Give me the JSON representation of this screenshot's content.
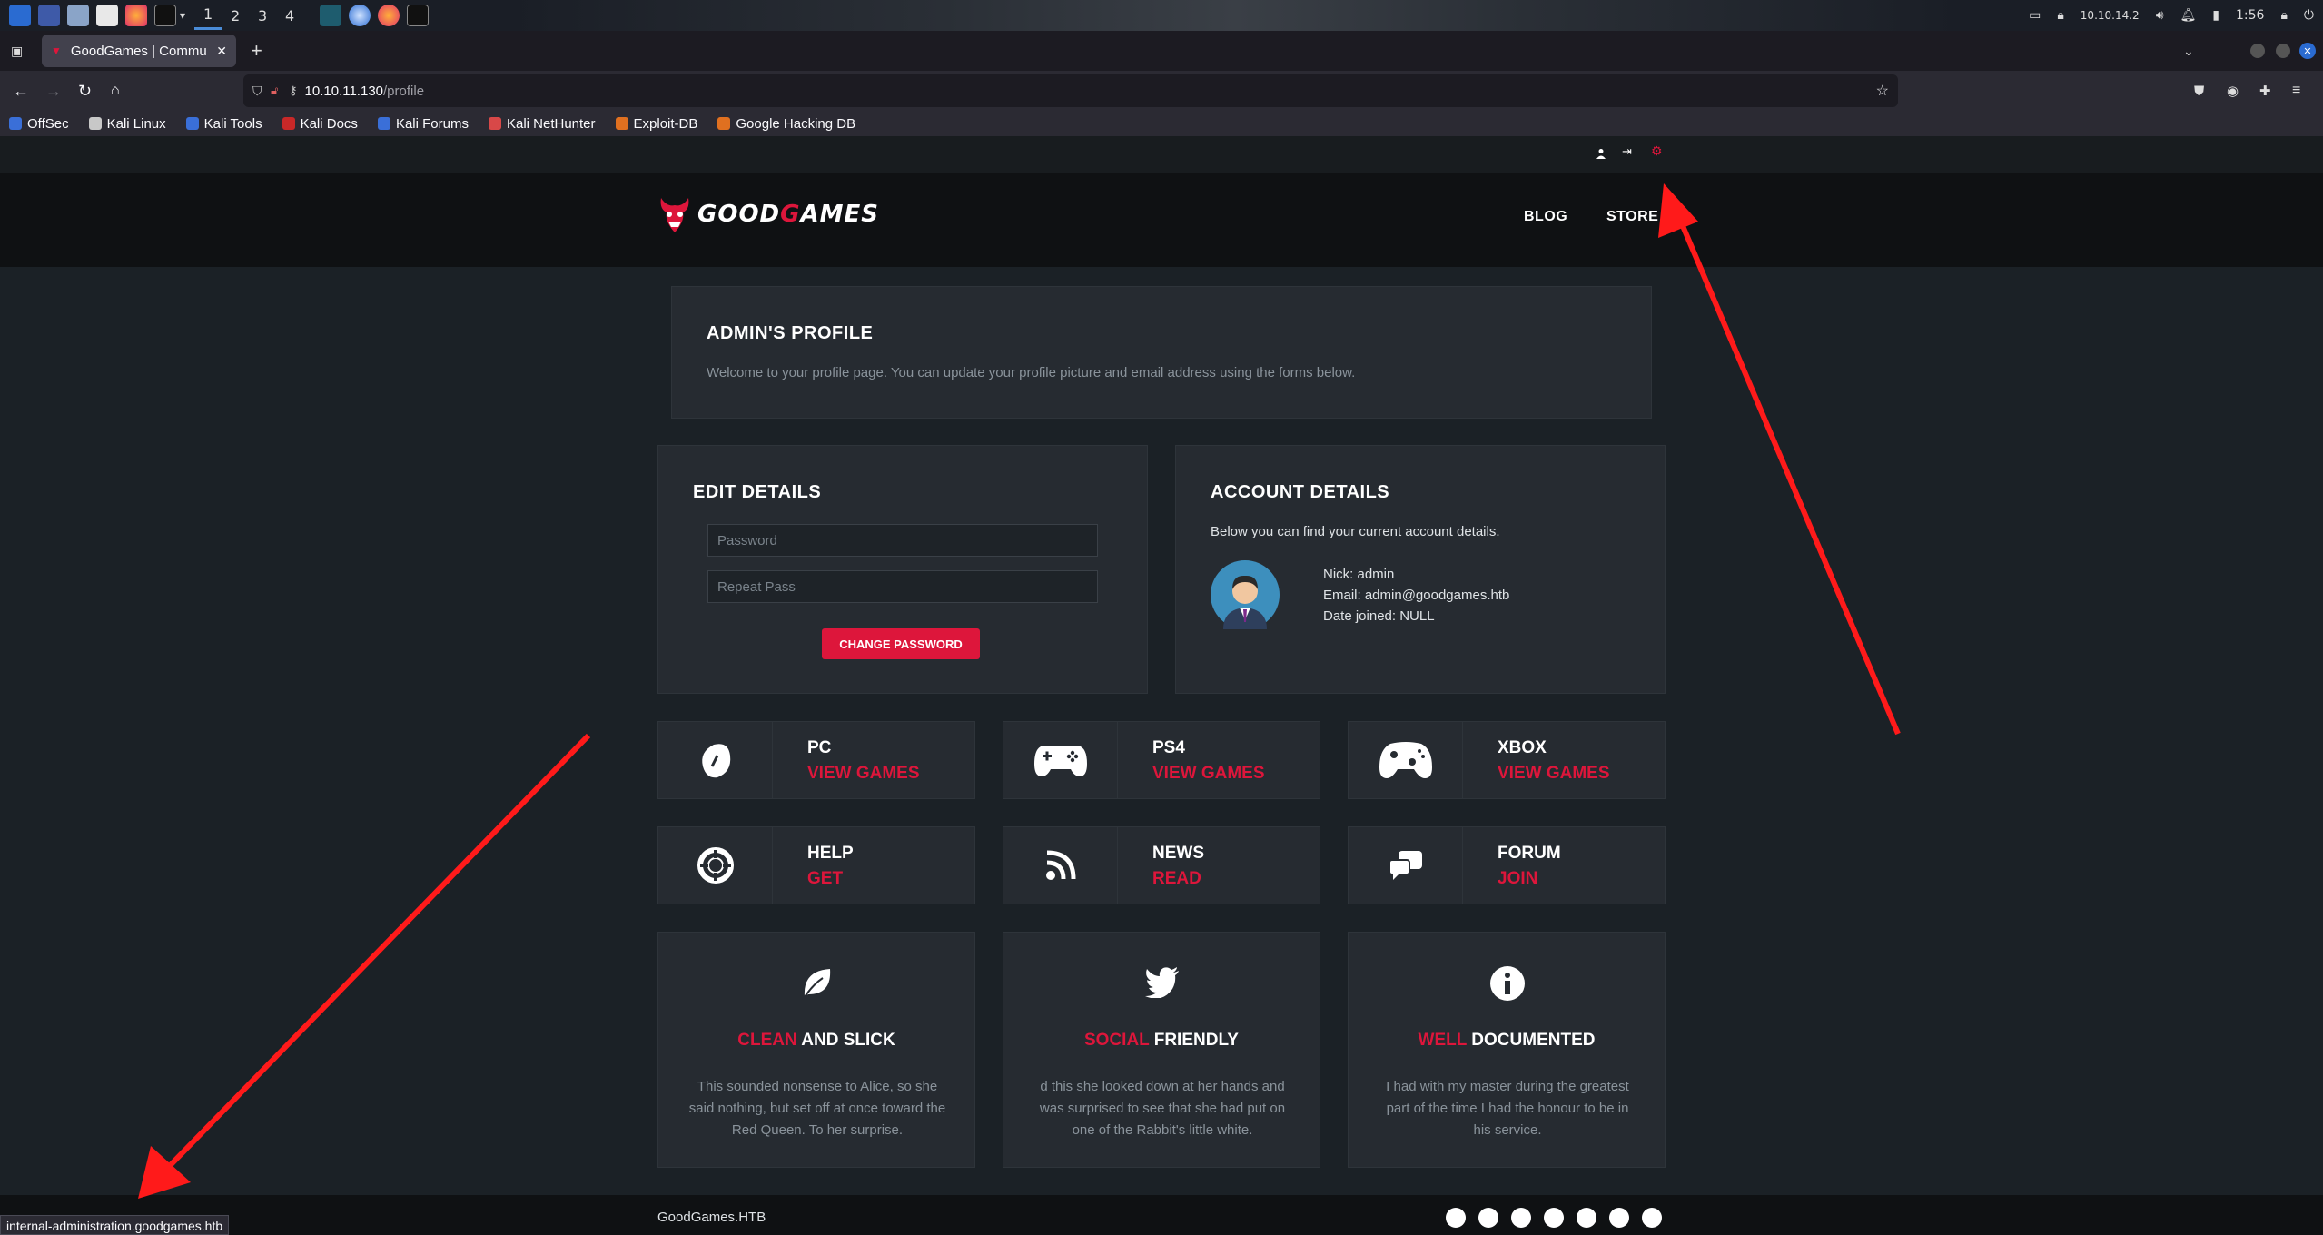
{
  "taskbar": {
    "workspaces": [
      "1",
      "2",
      "3",
      "4"
    ],
    "tray": {
      "ip": "10.10.14.2",
      "time": "1:56"
    }
  },
  "browser": {
    "tab_title": "GoodGames | Community",
    "url_host": "10.10.11.130",
    "url_path": "/profile",
    "bookmarks": [
      "OffSec",
      "Kali Linux",
      "Kali Tools",
      "Kali Docs",
      "Kali Forums",
      "Kali NetHunter",
      "Exploit-DB",
      "Google Hacking DB"
    ],
    "status_url": "internal-administration.goodgames.htb"
  },
  "site": {
    "logo_left": "GOOD",
    "logo_g": "G",
    "logo_right": "AMES",
    "nav": [
      "BLOG",
      "STORE"
    ],
    "profile": {
      "title": "ADMIN'S PROFILE",
      "welcome": "Welcome to your profile page. You can update your profile picture and email address using the forms below."
    },
    "edit": {
      "title": "EDIT DETAILS",
      "password_placeholder": "Password",
      "repeat_placeholder": "Repeat Pass",
      "button": "CHANGE PASSWORD"
    },
    "account": {
      "title": "ACCOUNT DETAILS",
      "intro": "Below you can find your current account details.",
      "nick": "Nick: admin",
      "email": "Email: admin@goodgames.htb",
      "joined": "Date joined: NULL"
    },
    "cards": [
      {
        "title": "PC",
        "link": "VIEW GAMES"
      },
      {
        "title": "PS4",
        "link": "VIEW GAMES"
      },
      {
        "title": "XBOX",
        "link": "VIEW GAMES"
      },
      {
        "title": "HELP",
        "link": "GET"
      },
      {
        "title": "NEWS",
        "link": "READ"
      },
      {
        "title": "FORUM",
        "link": "JOIN"
      }
    ],
    "features": [
      {
        "red": "CLEAN",
        "white": " AND SLICK",
        "desc": "This sounded nonsense to Alice, so she said nothing, but set off at once toward the Red Queen. To her surprise."
      },
      {
        "red": "SOCIAL",
        "white": " FRIENDLY",
        "desc": "d this she looked down at her hands and was surprised to see that she had put on one of the Rabbit's little white."
      },
      {
        "red": "WELL",
        "white": " DOCUMENTED",
        "desc": "I had with my master during the greatest part of the time I had the honour to be in his service."
      }
    ],
    "footer_brand": "GoodGames.HTB"
  },
  "colors": {
    "accent": "#dd163b",
    "annotation_arrow": "#ff1a1a"
  }
}
